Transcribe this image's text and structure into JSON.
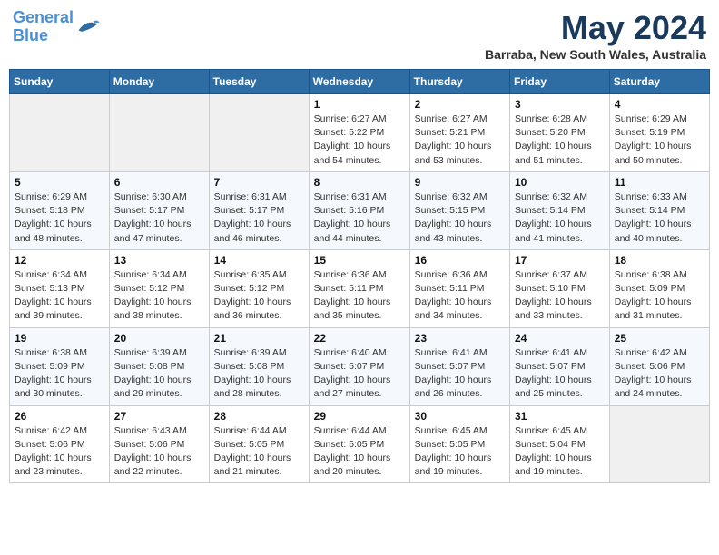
{
  "header": {
    "logo_line1": "General",
    "logo_line2": "Blue",
    "month": "May 2024",
    "location": "Barraba, New South Wales, Australia"
  },
  "weekdays": [
    "Sunday",
    "Monday",
    "Tuesday",
    "Wednesday",
    "Thursday",
    "Friday",
    "Saturday"
  ],
  "weeks": [
    [
      {
        "day": "",
        "info": ""
      },
      {
        "day": "",
        "info": ""
      },
      {
        "day": "",
        "info": ""
      },
      {
        "day": "1",
        "info": "Sunrise: 6:27 AM\nSunset: 5:22 PM\nDaylight: 10 hours\nand 54 minutes."
      },
      {
        "day": "2",
        "info": "Sunrise: 6:27 AM\nSunset: 5:21 PM\nDaylight: 10 hours\nand 53 minutes."
      },
      {
        "day": "3",
        "info": "Sunrise: 6:28 AM\nSunset: 5:20 PM\nDaylight: 10 hours\nand 51 minutes."
      },
      {
        "day": "4",
        "info": "Sunrise: 6:29 AM\nSunset: 5:19 PM\nDaylight: 10 hours\nand 50 minutes."
      }
    ],
    [
      {
        "day": "5",
        "info": "Sunrise: 6:29 AM\nSunset: 5:18 PM\nDaylight: 10 hours\nand 48 minutes."
      },
      {
        "day": "6",
        "info": "Sunrise: 6:30 AM\nSunset: 5:17 PM\nDaylight: 10 hours\nand 47 minutes."
      },
      {
        "day": "7",
        "info": "Sunrise: 6:31 AM\nSunset: 5:17 PM\nDaylight: 10 hours\nand 46 minutes."
      },
      {
        "day": "8",
        "info": "Sunrise: 6:31 AM\nSunset: 5:16 PM\nDaylight: 10 hours\nand 44 minutes."
      },
      {
        "day": "9",
        "info": "Sunrise: 6:32 AM\nSunset: 5:15 PM\nDaylight: 10 hours\nand 43 minutes."
      },
      {
        "day": "10",
        "info": "Sunrise: 6:32 AM\nSunset: 5:14 PM\nDaylight: 10 hours\nand 41 minutes."
      },
      {
        "day": "11",
        "info": "Sunrise: 6:33 AM\nSunset: 5:14 PM\nDaylight: 10 hours\nand 40 minutes."
      }
    ],
    [
      {
        "day": "12",
        "info": "Sunrise: 6:34 AM\nSunset: 5:13 PM\nDaylight: 10 hours\nand 39 minutes."
      },
      {
        "day": "13",
        "info": "Sunrise: 6:34 AM\nSunset: 5:12 PM\nDaylight: 10 hours\nand 38 minutes."
      },
      {
        "day": "14",
        "info": "Sunrise: 6:35 AM\nSunset: 5:12 PM\nDaylight: 10 hours\nand 36 minutes."
      },
      {
        "day": "15",
        "info": "Sunrise: 6:36 AM\nSunset: 5:11 PM\nDaylight: 10 hours\nand 35 minutes."
      },
      {
        "day": "16",
        "info": "Sunrise: 6:36 AM\nSunset: 5:11 PM\nDaylight: 10 hours\nand 34 minutes."
      },
      {
        "day": "17",
        "info": "Sunrise: 6:37 AM\nSunset: 5:10 PM\nDaylight: 10 hours\nand 33 minutes."
      },
      {
        "day": "18",
        "info": "Sunrise: 6:38 AM\nSunset: 5:09 PM\nDaylight: 10 hours\nand 31 minutes."
      }
    ],
    [
      {
        "day": "19",
        "info": "Sunrise: 6:38 AM\nSunset: 5:09 PM\nDaylight: 10 hours\nand 30 minutes."
      },
      {
        "day": "20",
        "info": "Sunrise: 6:39 AM\nSunset: 5:08 PM\nDaylight: 10 hours\nand 29 minutes."
      },
      {
        "day": "21",
        "info": "Sunrise: 6:39 AM\nSunset: 5:08 PM\nDaylight: 10 hours\nand 28 minutes."
      },
      {
        "day": "22",
        "info": "Sunrise: 6:40 AM\nSunset: 5:07 PM\nDaylight: 10 hours\nand 27 minutes."
      },
      {
        "day": "23",
        "info": "Sunrise: 6:41 AM\nSunset: 5:07 PM\nDaylight: 10 hours\nand 26 minutes."
      },
      {
        "day": "24",
        "info": "Sunrise: 6:41 AM\nSunset: 5:07 PM\nDaylight: 10 hours\nand 25 minutes."
      },
      {
        "day": "25",
        "info": "Sunrise: 6:42 AM\nSunset: 5:06 PM\nDaylight: 10 hours\nand 24 minutes."
      }
    ],
    [
      {
        "day": "26",
        "info": "Sunrise: 6:42 AM\nSunset: 5:06 PM\nDaylight: 10 hours\nand 23 minutes."
      },
      {
        "day": "27",
        "info": "Sunrise: 6:43 AM\nSunset: 5:06 PM\nDaylight: 10 hours\nand 22 minutes."
      },
      {
        "day": "28",
        "info": "Sunrise: 6:44 AM\nSunset: 5:05 PM\nDaylight: 10 hours\nand 21 minutes."
      },
      {
        "day": "29",
        "info": "Sunrise: 6:44 AM\nSunset: 5:05 PM\nDaylight: 10 hours\nand 20 minutes."
      },
      {
        "day": "30",
        "info": "Sunrise: 6:45 AM\nSunset: 5:05 PM\nDaylight: 10 hours\nand 19 minutes."
      },
      {
        "day": "31",
        "info": "Sunrise: 6:45 AM\nSunset: 5:04 PM\nDaylight: 10 hours\nand 19 minutes."
      },
      {
        "day": "",
        "info": ""
      }
    ]
  ]
}
